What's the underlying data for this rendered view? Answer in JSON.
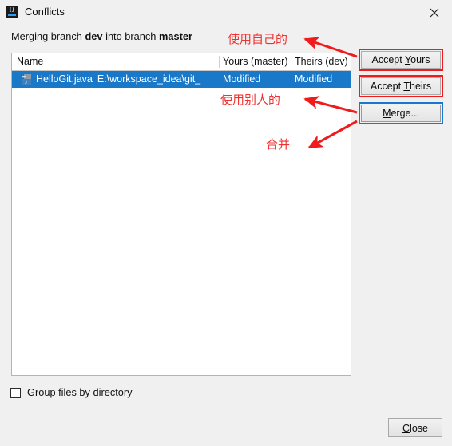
{
  "window": {
    "title": "Conflicts",
    "app_icon": "intellij-idea-icon",
    "close_icon": "close-icon"
  },
  "message": {
    "prefix": "Merging branch ",
    "source_branch": "dev",
    "middle": " into branch ",
    "target_branch": "master"
  },
  "table": {
    "columns": [
      {
        "label": "Name"
      },
      {
        "label": "Yours (master)"
      },
      {
        "label": "Theirs (dev)"
      }
    ],
    "rows": [
      {
        "icon": "java-file-icon",
        "file_name": "HelloGit.java",
        "file_path": "E:\\workspace_idea\\git_",
        "yours": "Modified",
        "theirs": "Modified",
        "selected": true
      }
    ]
  },
  "buttons": {
    "accept_yours": {
      "prefix": "Accept ",
      "mnemonic": "Y",
      "suffix": "ours"
    },
    "accept_theirs": {
      "prefix": "Accept ",
      "mnemonic": "T",
      "suffix": "heirs"
    },
    "merge": {
      "prefix": "",
      "mnemonic": "M",
      "suffix": "erge..."
    },
    "close": {
      "prefix": "",
      "mnemonic": "C",
      "suffix": "lose"
    }
  },
  "footer": {
    "group_files_label": "Group files by directory",
    "group_files_checked": false
  },
  "annotations": [
    {
      "text": "使用自己的",
      "target": "accept-yours-button",
      "color": "#f03232"
    },
    {
      "text": "使用别人的",
      "target": "accept-theirs-button",
      "color": "#f03232"
    },
    {
      "text": "合并",
      "target": "merge-button",
      "color": "#f03232"
    }
  ],
  "colors": {
    "selection_blue": "#1978c8",
    "annotation_red": "#ee1c1c",
    "annotation_blue": "#1878d0",
    "dialog_background": "#f0f0f0",
    "table_background": "#ffffff"
  }
}
